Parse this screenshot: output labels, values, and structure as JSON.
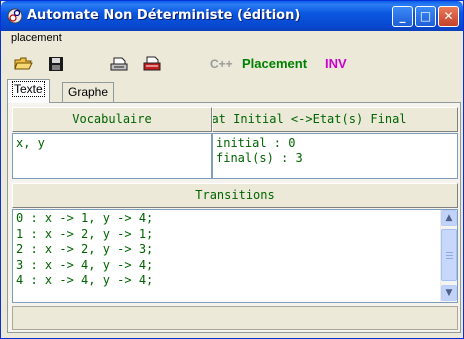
{
  "window": {
    "title": "Automate Non Déterministe (édition)",
    "minimize_glyph": "_",
    "maximize_glyph": "□",
    "close_glyph": "✕"
  },
  "menu": {
    "items": [
      {
        "label": "placement"
      }
    ]
  },
  "toolbar": {
    "icons": [
      "open-folder-icon",
      "save-icon",
      "print-icon",
      "print-color-icon"
    ],
    "cpp_label": "C++",
    "placement_label": "Placement",
    "inv_label": "INV",
    "colors": {
      "cpp": "#9a9a9a",
      "placement": "#008000",
      "inv": "#d000d0"
    }
  },
  "tabs": [
    {
      "label": "Texte",
      "active": true
    },
    {
      "label": "Graphe",
      "active": false
    }
  ],
  "vocabulaire": {
    "header": "Vocabulaire",
    "value": "x, y"
  },
  "etats": {
    "header": "Etat Initial <->Etat(s) Final",
    "lines": [
      "initial : 0",
      "final(s) : 3"
    ]
  },
  "transitions": {
    "header": "Transitions",
    "lines": [
      "0 : x -> 1, y -> 4;",
      "1 : x -> 2, y -> 1;",
      "2 : x -> 2, y -> 3;",
      "3 : x -> 4, y -> 4;",
      "4 : x -> 4, y -> 4;"
    ]
  },
  "text_color": "#006400"
}
